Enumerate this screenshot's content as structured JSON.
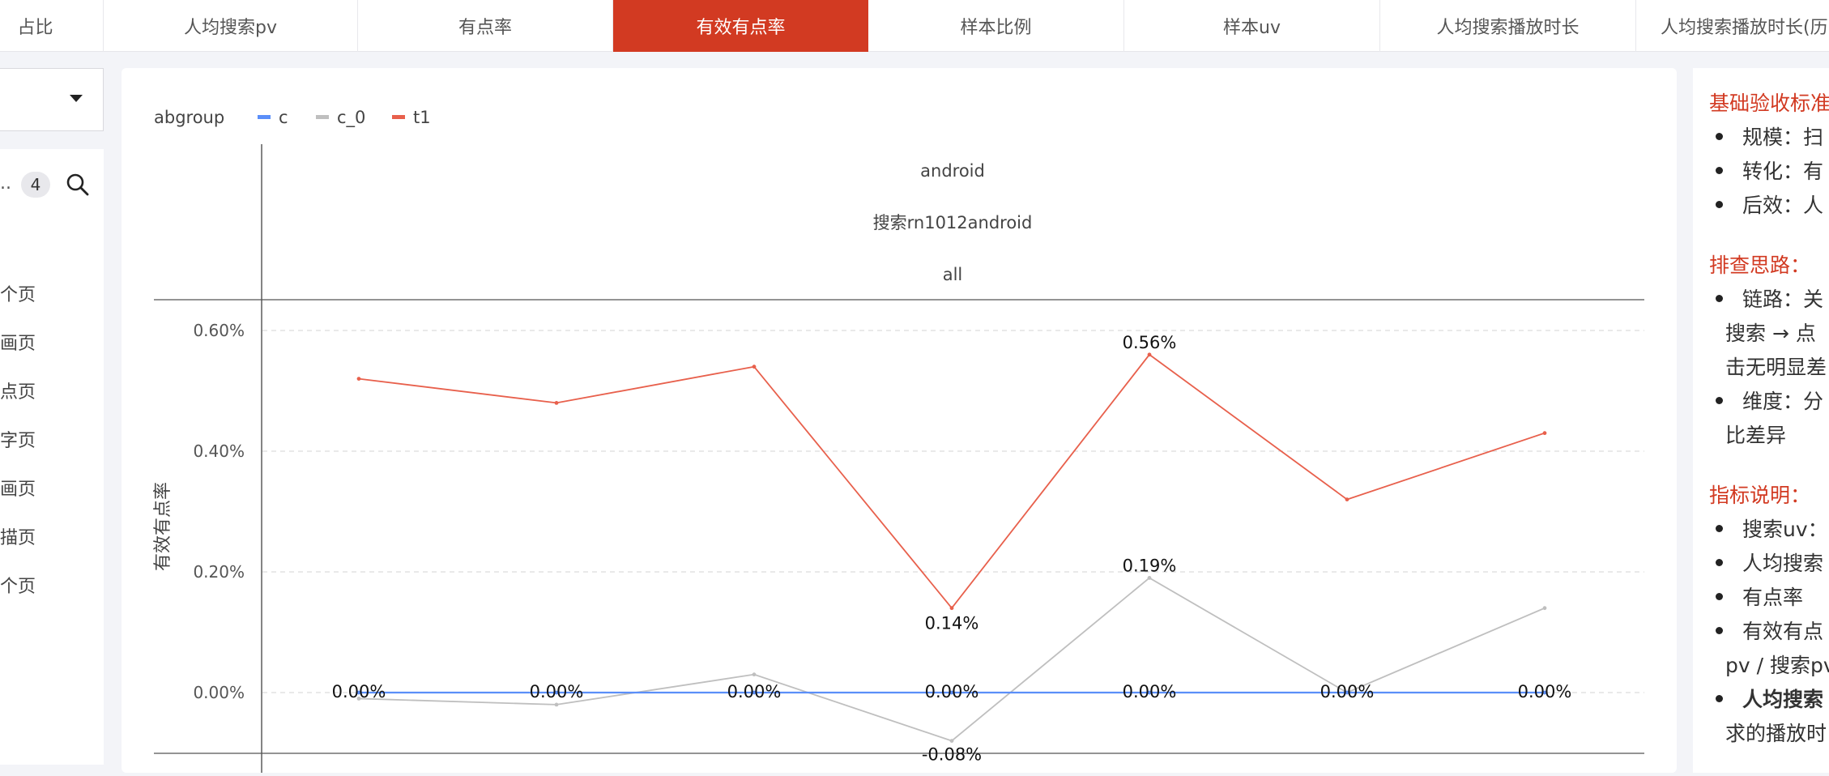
{
  "tabs": [
    {
      "label": "占比",
      "display": "占比"
    },
    {
      "label": "人均搜索pv"
    },
    {
      "label": "有点率"
    },
    {
      "label": "有效有点率"
    },
    {
      "label": "样本比例"
    },
    {
      "label": "样本uv"
    },
    {
      "label": "人均搜索播放时长"
    },
    {
      "label": "人均搜索播放时长(历"
    }
  ],
  "active_tab_index": 3,
  "colors": {
    "accent": "#d23a22",
    "series_c": "#5b8ff9",
    "series_c0": "#bfbfbf",
    "series_t1": "#e8604c"
  },
  "left_panel": {
    "filter_count": "4",
    "ellipsis": "..",
    "items": [
      "个页",
      "画页",
      "点页",
      "字页",
      "画页",
      "描页",
      "个页"
    ]
  },
  "chart_data": {
    "type": "line",
    "legend_title": "abgroup",
    "facet_labels": [
      "android",
      "搜索rn1012android",
      "all"
    ],
    "ylabel": "有效有点率",
    "ylim": [
      -0.1,
      0.65
    ],
    "yticks": [
      "0.60%",
      "0.40%",
      "0.20%",
      "0.00%"
    ],
    "ytick_values": [
      0.6,
      0.4,
      0.2,
      0.0
    ],
    "series": [
      {
        "name": "c",
        "values": [
          0,
          0,
          0,
          0,
          0,
          0,
          0
        ],
        "labels": [
          "0.00%",
          "0.00%",
          "0.00%",
          "0.00%",
          "0.00%",
          "0.00%",
          "0.00%"
        ]
      },
      {
        "name": "c_0",
        "values": [
          -0.01,
          -0.02,
          0.03,
          -0.08,
          0.19,
          0.0,
          0.14
        ],
        "labels": [
          "",
          "",
          "",
          "-0.08%",
          "0.19%",
          "",
          ""
        ]
      },
      {
        "name": "t1",
        "values": [
          0.52,
          0.48,
          0.54,
          0.14,
          0.56,
          0.32,
          0.43
        ],
        "labels": [
          "",
          "",
          "",
          "0.14%",
          "0.56%",
          "",
          ""
        ]
      }
    ]
  },
  "right_panel": {
    "section1_title": "基础验收标准",
    "section1_items": [
      "规模：扫",
      "转化：有",
      "后效：人"
    ],
    "section2_title": "排查思路：",
    "section2_item1": "链路：关",
    "section2_cont1a": "搜索 → 点",
    "section2_cont1b": "击无明显差",
    "section2_item2": "维度：分",
    "section2_cont2": "比差异",
    "section3_title": "指标说明：",
    "section3_items": [
      "搜索uv：",
      "人均搜索",
      "有点率",
      "有效有点"
    ],
    "section3_cont": "pv / 搜索pv",
    "section3_bold": "人均搜索",
    "section3_last": "求的播放时"
  }
}
